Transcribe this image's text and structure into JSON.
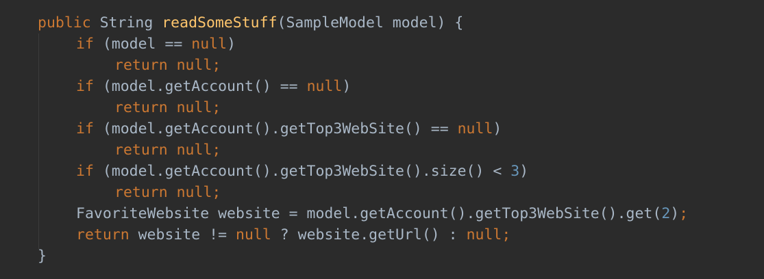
{
  "colors": {
    "background": "#2b2b2b",
    "keyword": "#cc7832",
    "method_declaration": "#ffc66d",
    "number": "#6897bb",
    "default_text": "#a9b7c6"
  },
  "code_lines": [
    {
      "indent": 1,
      "tokens": [
        {
          "text": "public",
          "kind": "kw"
        },
        {
          "text": " String ",
          "kind": "plain"
        },
        {
          "text": "readSomeStuff",
          "kind": "fn"
        },
        {
          "text": "(SampleModel model) {",
          "kind": "plain"
        }
      ]
    },
    {
      "indent": 2,
      "tokens": [
        {
          "text": "if",
          "kind": "kw"
        },
        {
          "text": " (model == ",
          "kind": "plain"
        },
        {
          "text": "null",
          "kind": "kw"
        },
        {
          "text": ")",
          "kind": "plain"
        }
      ]
    },
    {
      "indent": 3,
      "tokens": [
        {
          "text": "return null;",
          "kind": "kw"
        }
      ]
    },
    {
      "indent": 2,
      "tokens": [
        {
          "text": "if",
          "kind": "kw"
        },
        {
          "text": " (model.getAccount() == ",
          "kind": "plain"
        },
        {
          "text": "null",
          "kind": "kw"
        },
        {
          "text": ")",
          "kind": "plain"
        }
      ]
    },
    {
      "indent": 3,
      "tokens": [
        {
          "text": "return null;",
          "kind": "kw"
        }
      ]
    },
    {
      "indent": 2,
      "tokens": [
        {
          "text": "if",
          "kind": "kw"
        },
        {
          "text": " (model.getAccount().getTop3WebSite() == ",
          "kind": "plain"
        },
        {
          "text": "null",
          "kind": "kw"
        },
        {
          "text": ")",
          "kind": "plain"
        }
      ]
    },
    {
      "indent": 3,
      "tokens": [
        {
          "text": "return null;",
          "kind": "kw"
        }
      ]
    },
    {
      "indent": 2,
      "tokens": [
        {
          "text": "if",
          "kind": "kw"
        },
        {
          "text": " (model.getAccount().getTop3WebSite().size() < ",
          "kind": "plain"
        },
        {
          "text": "3",
          "kind": "num"
        },
        {
          "text": ")",
          "kind": "plain"
        }
      ]
    },
    {
      "indent": 3,
      "tokens": [
        {
          "text": "return null;",
          "kind": "kw"
        }
      ]
    },
    {
      "indent": 2,
      "tokens": [
        {
          "text": "FavoriteWebsite website = model.getAccount().getTop3WebSite().get(",
          "kind": "plain"
        },
        {
          "text": "2",
          "kind": "num"
        },
        {
          "text": ")",
          "kind": "plain"
        },
        {
          "text": ";",
          "kind": "kw"
        }
      ]
    },
    {
      "indent": 2,
      "tokens": [
        {
          "text": "return",
          "kind": "kw"
        },
        {
          "text": " website != ",
          "kind": "plain"
        },
        {
          "text": "null",
          "kind": "kw"
        },
        {
          "text": " ? website.getUrl() : ",
          "kind": "plain"
        },
        {
          "text": "null;",
          "kind": "kw"
        }
      ]
    },
    {
      "indent": 1,
      "tokens": [
        {
          "text": "}",
          "kind": "plain"
        }
      ]
    }
  ]
}
